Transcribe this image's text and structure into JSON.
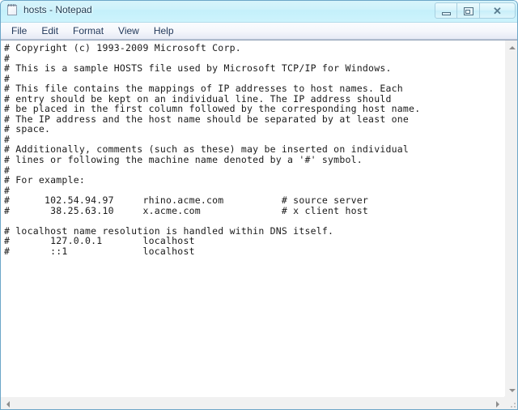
{
  "window": {
    "title": "hosts - Notepad",
    "icon": "notepad-icon",
    "accent_titlebar": "#cdf2fb",
    "border_color": "#6ca6c8"
  },
  "titlebar_buttons": [
    {
      "name": "minimize-button",
      "label": "",
      "glyph": "minimize"
    },
    {
      "name": "maximize-button",
      "label": "",
      "glyph": "restore"
    },
    {
      "name": "close-button",
      "label": "✕",
      "glyph": "close"
    }
  ],
  "menubar": {
    "items": [
      {
        "label": "File"
      },
      {
        "label": "Edit"
      },
      {
        "label": "Format"
      },
      {
        "label": "View"
      },
      {
        "label": "Help"
      }
    ]
  },
  "editor": {
    "text_color": "#1a1a1a",
    "background": "#ffffff",
    "lines": [
      "# Copyright (c) 1993-2009 Microsoft Corp.",
      "#",
      "# This is a sample HOSTS file used by Microsoft TCP/IP for Windows.",
      "#",
      "# This file contains the mappings of IP addresses to host names. Each",
      "# entry should be kept on an individual line. The IP address should",
      "# be placed in the first column followed by the corresponding host name.",
      "# The IP address and the host name should be separated by at least one",
      "# space.",
      "#",
      "# Additionally, comments (such as these) may be inserted on individual",
      "# lines or following the machine name denoted by a '#' symbol.",
      "#",
      "# For example:",
      "#",
      "#      102.54.94.97     rhino.acme.com          # source server",
      "#       38.25.63.10     x.acme.com              # x client host",
      "",
      "# localhost name resolution is handled within DNS itself.",
      "#       127.0.0.1       localhost",
      "#       ::1             localhost"
    ]
  },
  "scrollbars": {
    "vertical": {
      "up_arrow": "scroll-up-arrow",
      "down_arrow": "scroll-down-arrow"
    },
    "horizontal": {
      "left_arrow": "scroll-left-arrow",
      "right_arrow": "scroll-right-arrow"
    }
  }
}
